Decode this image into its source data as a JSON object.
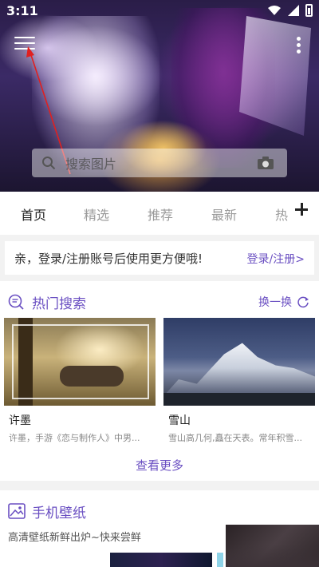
{
  "status_bar": {
    "time": "3:11"
  },
  "search": {
    "placeholder": "搜索图片"
  },
  "tabs": [
    {
      "label": "首页",
      "active": true
    },
    {
      "label": "精选",
      "active": false
    },
    {
      "label": "推荐",
      "active": false
    },
    {
      "label": "最新",
      "active": false
    },
    {
      "label": "热",
      "active": false
    }
  ],
  "login_banner": {
    "text": "亲，登录/注册账号后使用更方便哦!",
    "link": "登录/注册>"
  },
  "hot_search": {
    "title": "热门搜索",
    "refresh_label": "换一换",
    "cards": [
      {
        "title": "许墨",
        "desc": "许墨，手游《恋与制作人》中男..."
      },
      {
        "title": "雪山",
        "desc": "雪山高几何,矗在天表。常年积雪..."
      }
    ],
    "see_more": "查看更多"
  },
  "wallpaper": {
    "title": "手机壁纸",
    "subtitle": "高清壁纸新鲜出炉~快来尝鲜"
  },
  "colors": {
    "accent": "#6a4fc2",
    "annotation_arrow": "#e02020"
  }
}
